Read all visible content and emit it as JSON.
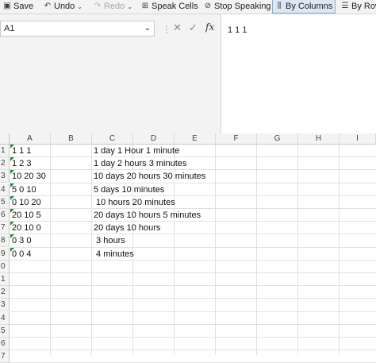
{
  "toolbar": {
    "save": "Save",
    "undo": "Undo",
    "redo": "Redo",
    "speak_cells": "Speak Cells",
    "stop_speaking": "Stop Speaking",
    "by_columns": "By Columns",
    "by_rows": "By Row"
  },
  "formula_bar": {
    "name_box": "A1",
    "fx": "fx",
    "content": "1 1 1"
  },
  "columns": [
    "A",
    "B",
    "C",
    "D",
    "E",
    "F",
    "G",
    "H",
    "I"
  ],
  "rows": [
    "1",
    "2",
    "3",
    "4",
    "5",
    "6",
    "7",
    "8",
    "9",
    "0",
    "1",
    "2",
    "3",
    "4",
    "5",
    "6",
    "7"
  ],
  "cells": {
    "a": [
      "1 1 1",
      "1 2 3",
      "10 20 30",
      "5 0 10",
      "0 10 20",
      "20 10 5",
      "20 10 0",
      "0 3 0",
      "0 0 4"
    ],
    "c": [
      "1 day 1 Hour 1 minute",
      "1 day 2 hours 3 minutes",
      "10 days 20 hours 30 minutes",
      "5 days 10 minutes",
      " 10 hours 20 minutes",
      "20 days 10 hours 5 minutes",
      "20 days 10 hours",
      " 3 hours",
      " 4 minutes"
    ]
  },
  "colors": {
    "error_indicator": "#1e8a3a",
    "active_button_bg": "#dbe7f5"
  }
}
